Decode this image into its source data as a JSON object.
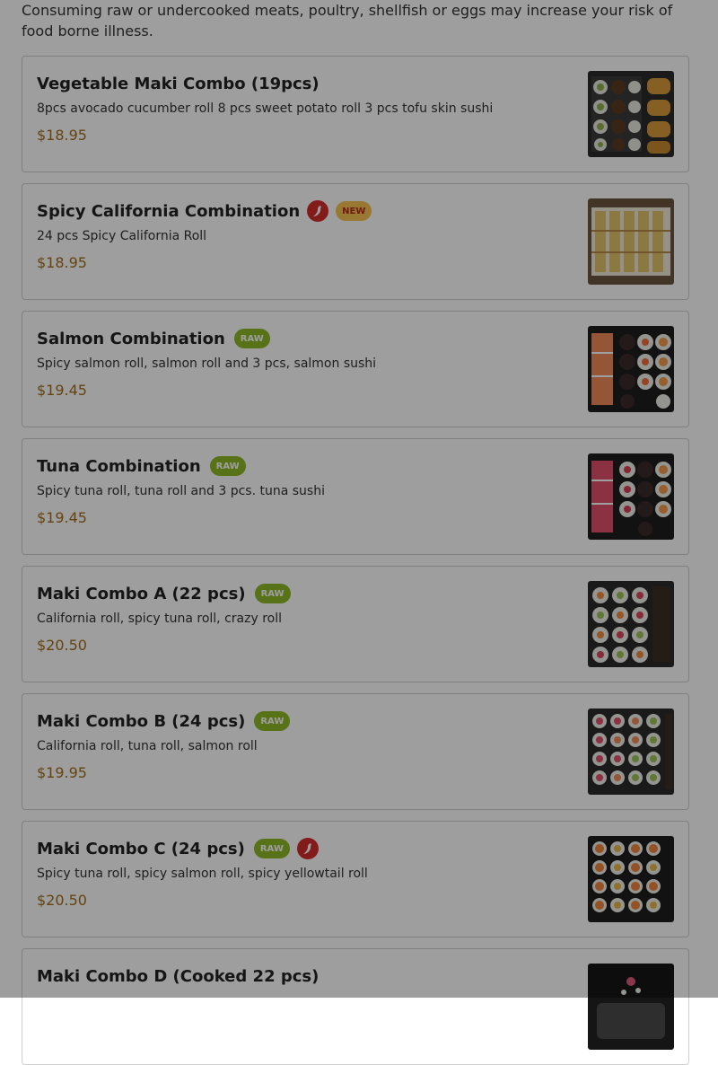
{
  "notice": "Consuming raw or undercooked meats, poultry, shellfish or eggs may increase your risk of food borne illness.",
  "badges": {
    "raw": "RAW",
    "new": "NEW"
  },
  "colors": {
    "price": "#a36d1a",
    "raw_badge": "#8fb828",
    "new_badge": "#f5c253",
    "spicy": "#d42d2d"
  },
  "items": [
    {
      "name": "Vegetable Maki Combo (19pcs)",
      "description": "8pcs avocado cucumber roll 8 pcs sweet potato roll 3 pcs tofu skin sushi",
      "price": "$18.95",
      "raw": false,
      "spicy": false,
      "is_new": false
    },
    {
      "name": "Spicy California Combination",
      "description": "24 pcs Spicy California Roll",
      "price": "$18.95",
      "raw": false,
      "spicy": true,
      "is_new": true
    },
    {
      "name": "Salmon Combination",
      "description": "Spicy salmon roll, salmon roll and 3 pcs, salmon sushi",
      "price": "$19.45",
      "raw": true,
      "spicy": false,
      "is_new": false
    },
    {
      "name": "Tuna Combination",
      "description": "Spicy tuna roll, tuna roll and 3 pcs. tuna sushi",
      "price": "$19.45",
      "raw": true,
      "spicy": false,
      "is_new": false
    },
    {
      "name": "Maki Combo A (22 pcs)",
      "description": "California roll, spicy tuna roll, crazy roll",
      "price": "$20.50",
      "raw": true,
      "spicy": false,
      "is_new": false
    },
    {
      "name": "Maki Combo B (24 pcs)",
      "description": "California roll, tuna roll, salmon roll",
      "price": "$19.95",
      "raw": true,
      "spicy": false,
      "is_new": false
    },
    {
      "name": "Maki Combo C (24 pcs)",
      "description": "Spicy tuna roll, spicy salmon roll, spicy yellowtail roll",
      "price": "$20.50",
      "raw": true,
      "spicy": true,
      "is_new": false
    },
    {
      "name": "Maki Combo D (Cooked 22 pcs)",
      "description": "",
      "price": "",
      "raw": false,
      "spicy": false,
      "is_new": false
    }
  ]
}
